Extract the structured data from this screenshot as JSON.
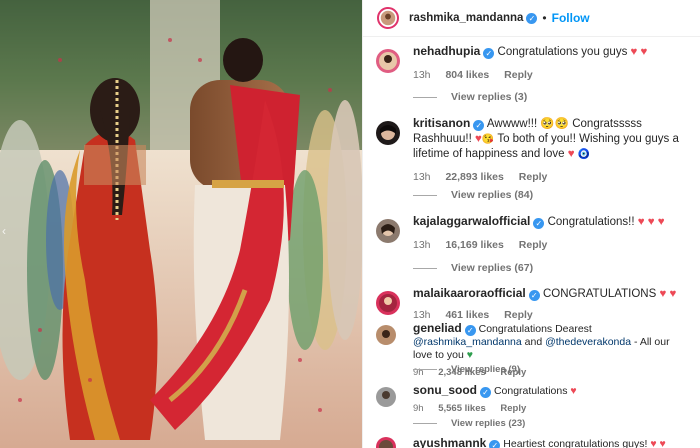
{
  "post": {
    "author": "rashmika_mandanna",
    "follow_label": "Follow",
    "separator": "•"
  },
  "comments": [
    {
      "user": "nehadhupia",
      "text": "Congratulations you guys",
      "emojis": "♥ ♥",
      "time": "13h",
      "likes": "804 likes",
      "reply_label": "Reply",
      "view_replies": "View replies (3)"
    },
    {
      "user": "kritisanon",
      "text_a": "Awwww!!! 🥺🥺 Congratsssss Rashhuuu!!",
      "text_b": "To both of you!! Wishing you guys a lifetime of happiness and love",
      "time": "13h",
      "likes": "22,893 likes",
      "reply_label": "Reply",
      "view_replies": "View replies (84)"
    },
    {
      "user": "kajalaggarwalofficial",
      "text": "Congratulations!!",
      "time": "13h",
      "likes": "16,169 likes",
      "reply_label": "Reply",
      "view_replies": "View replies (67)"
    },
    {
      "user": "malaikaaroraofficial",
      "text": "CONGRATULATIONS",
      "time": "13h",
      "likes": "461 likes",
      "reply_label": "Reply"
    },
    {
      "user": "geneliad",
      "text_a": "Congratulations Dearest",
      "mention_a": "@rashmika_mandanna",
      "conj": "and",
      "mention_b": "@thedeverakonda",
      "text_b": "- All our love to you",
      "time": "9h",
      "likes": "2,348 likes",
      "reply_label": "Reply",
      "view_replies": "View replies (9)"
    },
    {
      "user": "sonu_sood",
      "text": "Congratulations",
      "time": "9h",
      "likes": "5,565 likes",
      "reply_label": "Reply",
      "view_replies": "View replies (23)"
    },
    {
      "user": "ayushmannk",
      "text": "Heartiest congratulations guys!"
    }
  ],
  "colors": {
    "accent": "#0095f6",
    "verified": "#3897f0",
    "heart": "#ed4956",
    "muted": "#737373"
  }
}
